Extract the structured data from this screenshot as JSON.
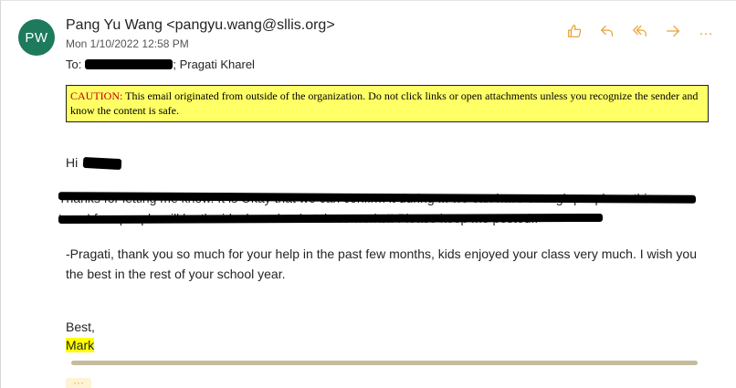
{
  "header": {
    "avatar_initials": "PW",
    "sender": "Pang Yu Wang <pangyu.wang@sllis.org>",
    "date": "Mon 1/10/2022 12:58 PM",
    "to_label": "To:",
    "to_visible_recipient": "; Pragati Kharel"
  },
  "toolbar": {
    "icons": [
      "thumbs-up-icon",
      "reply-icon",
      "reply-all-icon",
      "forward-icon",
      "more-icon"
    ],
    "more_label": "…"
  },
  "caution": {
    "label": "CAUTION:",
    "text": " This email originated from outside of the organization. Do not click links or open attachments unless you recognize the sender and know the content is safe."
  },
  "body": {
    "greeting": "Hi",
    "struck_line_1": "Thanks for letting me know. It is Okay that we can confirm it during ... we can have enough people on this",
    "struck_line_2": "team! four people will be the ideal number but three works!! Please keep me posted!!",
    "paragraph": "-Pragati, thank you so much for your help in the past few months, kids enjoyed your class very much. I wish you the best in the rest of your school year.",
    "closing": "Best,",
    "signature": "Mark"
  },
  "footer": {
    "expand_label": "···"
  },
  "colors": {
    "avatar_bg": "#1e7a5c",
    "action_icon": "#e8a33b",
    "caution_bg": "#ffff66",
    "caution_label": "#c00000",
    "signature_highlight": "#ffff00"
  }
}
